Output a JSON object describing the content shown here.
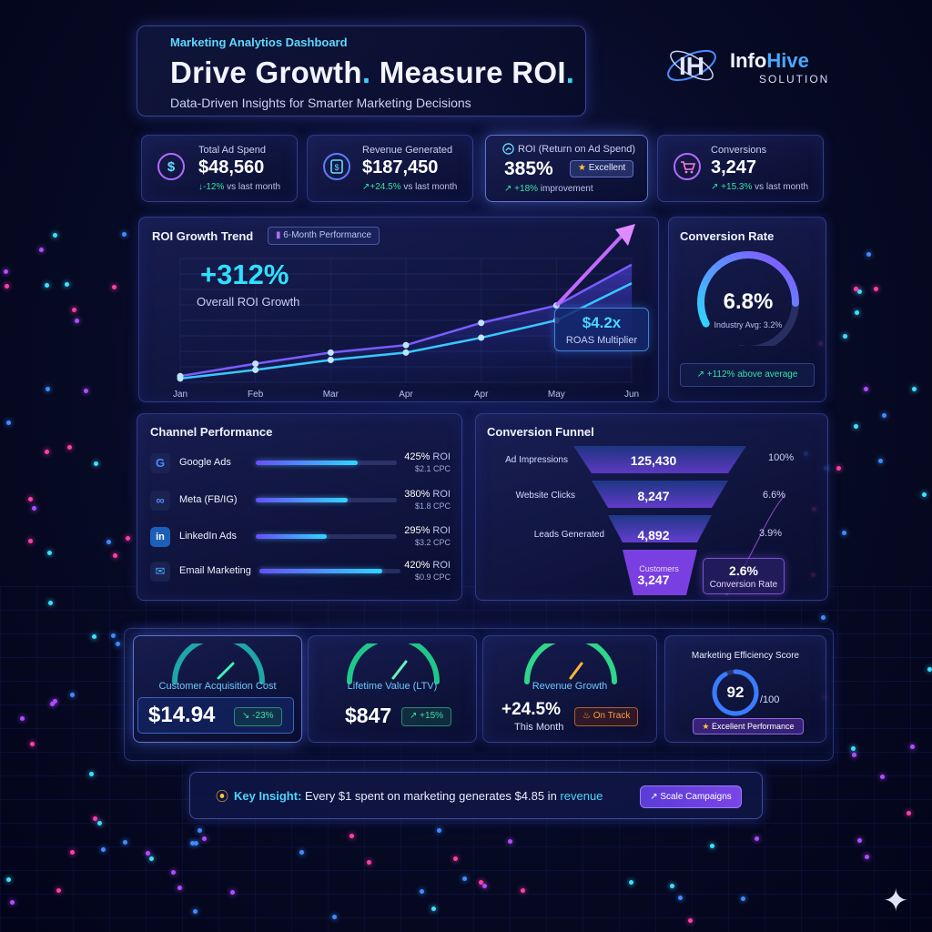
{
  "header": {
    "subtitle": "Marketing Analytios Dashboard",
    "title_part1": "Drive Growth",
    "title_part2": " Measure ROI",
    "tagline": "Data-Driven Insights for Smarter Marketing Decisions"
  },
  "logo": {
    "initials": "IH",
    "name_part1": "Info",
    "name_part2": "Hive",
    "sub": "SOLUTION"
  },
  "kpis": [
    {
      "label": "Total Ad Spend",
      "value": "$48,560",
      "delta": "-12%",
      "delta_suffix": " vs last month",
      "icon": "dollar-refresh-icon"
    },
    {
      "label": "Revenue Generated",
      "value": "$187,450",
      "delta": "+24.5%",
      "delta_suffix": " vs last month",
      "icon": "revenue-receipt-icon"
    },
    {
      "label": "ROI (Return on Ad Spend)",
      "value": "385%",
      "badge": "Excellent",
      "delta": "+18%",
      "delta_suffix": " improvement",
      "icon": "roi-chart-icon"
    },
    {
      "label": "Conversions",
      "value": "3,247",
      "delta": "+15.3%",
      "delta_suffix": " vs last month",
      "icon": "cart-icon"
    }
  ],
  "roi_chart": {
    "title": "ROI Growth Trend",
    "period_pill": "6-Month Performance",
    "headline_value": "+312%",
    "headline_label": "Overall ROI Growth",
    "roas_value": "$4.2x",
    "roas_label": "ROAS Multiplier"
  },
  "chart_data": {
    "type": "line",
    "categories": [
      "Jan",
      "Feb",
      "Mar",
      "Apr",
      "Apr",
      "May",
      "Jun"
    ],
    "series": [
      {
        "name": "",
        "values": [
          5,
          15,
          24,
          30,
          48,
          62,
          95
        ]
      },
      {
        "name": "",
        "values": [
          3,
          10,
          18,
          24,
          36,
          50,
          80
        ]
      }
    ],
    "color_primary": "#7a5cff",
    "color_secondary": "#38c8ff",
    "grid": true
  },
  "conversion_rate": {
    "title": "Conversion Rate",
    "value": "6.8%",
    "industry_avg": "Industry Avg: 3.2%",
    "above_avg": "+112% above average",
    "gauge_fraction": 0.68
  },
  "channels": {
    "title": "Channel Performance",
    "items": [
      {
        "name": "Google Ads",
        "roi": "425%",
        "roi_unit": " ROI",
        "cpc": "$2.1 CPC",
        "fill": 0.72,
        "icon_text": "G",
        "icon": "google-icon"
      },
      {
        "name": "Meta (FB/IG)",
        "roi": "380%",
        "roi_unit": " ROI",
        "cpc": "$1.8 CPC",
        "fill": 0.65,
        "icon_text": "∞",
        "icon": "meta-icon"
      },
      {
        "name": "LinkedIn Ads",
        "roi": "295%",
        "roi_unit": " ROI",
        "cpc": "$3.2 CPC",
        "fill": 0.5,
        "icon_text": "in",
        "icon": "linkedin-icon"
      },
      {
        "name": "Email Marketing",
        "roi": "420%",
        "roi_unit": " ROI",
        "cpc": "$0.9 CPC",
        "fill": 0.87,
        "icon_text": "✉",
        "icon": "email-icon"
      }
    ]
  },
  "funnel": {
    "title": "Conversion Funnel",
    "stages": [
      {
        "label": "Ad Impressions",
        "value": "125,430",
        "pct": "100%"
      },
      {
        "label": "Website Clicks",
        "value": "8,247",
        "pct": "6.6%"
      },
      {
        "label": "Leads Generated",
        "value": "4,892",
        "pct": "3.9%"
      },
      {
        "label": "Customers",
        "value": "3,247",
        "pct": ""
      }
    ],
    "conv_value": "2.6%",
    "conv_label": "Conversion Rate"
  },
  "bottom_metrics": {
    "cac": {
      "label": "Customer Acquisition Cost",
      "value": "$14.94",
      "delta": "-23%"
    },
    "ltv": {
      "label": "Lifetime Value (LTV)",
      "value": "$847",
      "delta": "+15%"
    },
    "revenue_growth": {
      "label": "Revenue Growth",
      "value": "+24.5%",
      "sub": "This Month",
      "status": "On Track"
    },
    "efficiency": {
      "label": "Marketing Efficiency Score",
      "value": "92",
      "max": "/100",
      "badge": "Excellent Performance",
      "fraction": 0.92
    }
  },
  "insight": {
    "key": "Key Insight:",
    "text": " Every $1 spent on marketing generates $4.85 in ",
    "highlight": "revenue",
    "button": "Scale Campaigns"
  },
  "colors": {
    "accent": "#2fd6ff",
    "purple": "#7a45e8",
    "positive": "#34e3a5",
    "warning": "#ff9a3a"
  }
}
